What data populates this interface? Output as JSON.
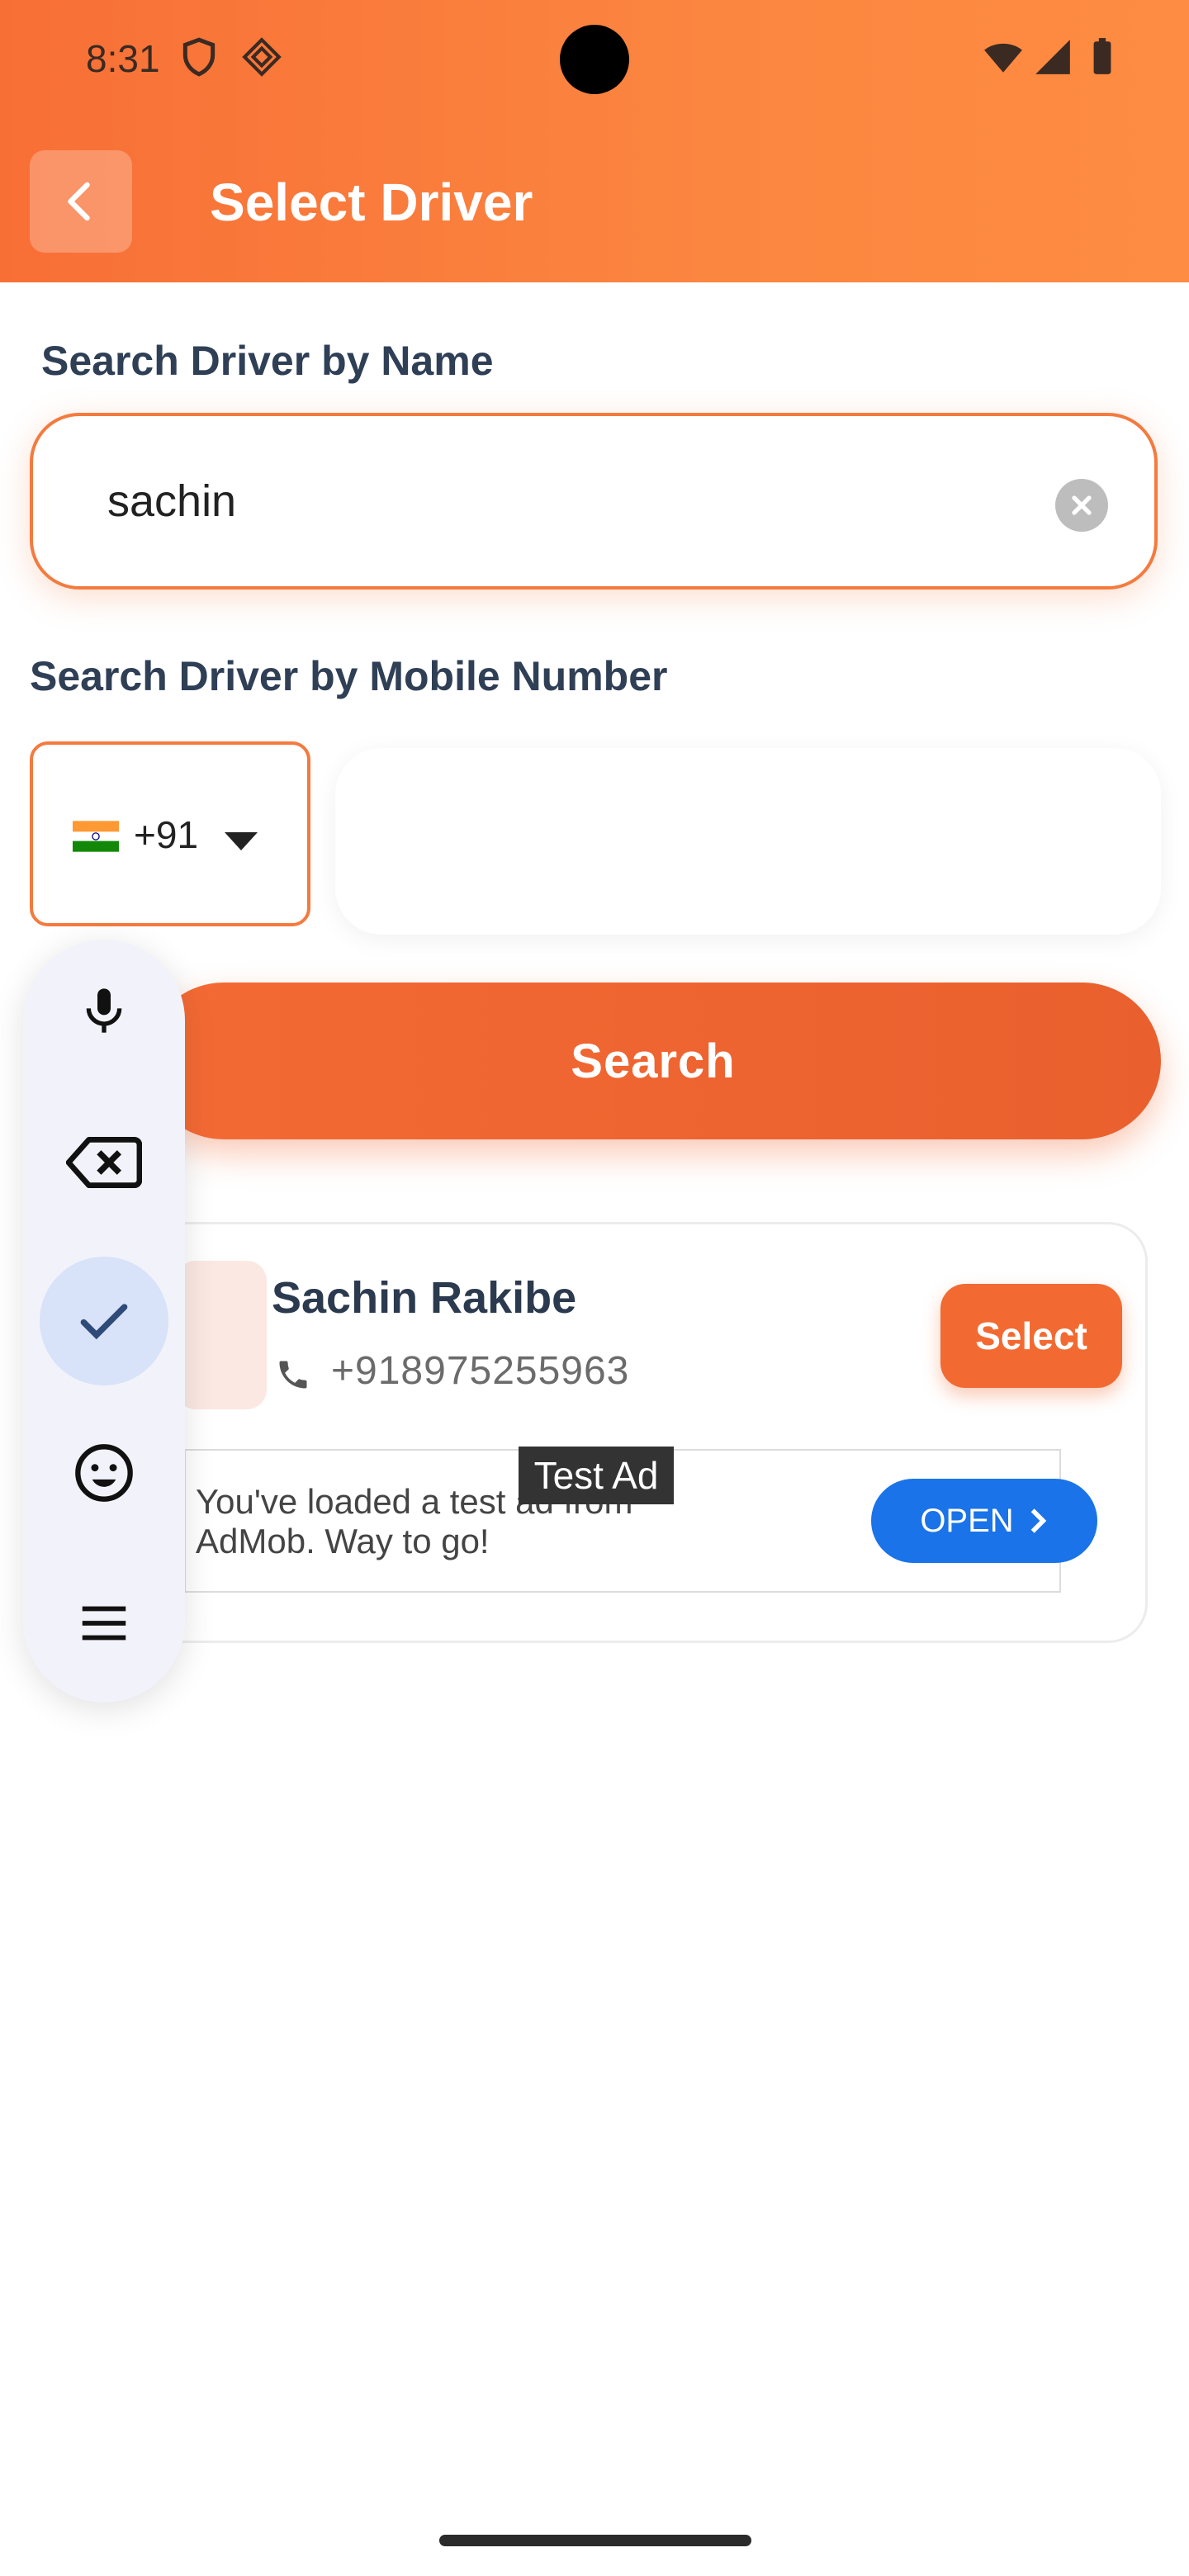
{
  "status_bar": {
    "time": "8:31"
  },
  "header": {
    "title": "Select Driver"
  },
  "search_by_name": {
    "label": "Search Driver by Name",
    "value": "sachin"
  },
  "search_by_mobile": {
    "label": "Search Driver by Mobile Number",
    "country_code": "+91",
    "value": ""
  },
  "search_button": {
    "label": "Search"
  },
  "result": {
    "name": "Sachin Rakibe",
    "phone": "+918975255963",
    "select_label": "Select"
  },
  "ad": {
    "badge": "Test Ad",
    "text": "You've loaded a test ad from AdMob. Way to go!",
    "cta": "OPEN"
  },
  "colors": {
    "accent": "#f26a32",
    "header_from": "#f86f36",
    "header_to": "#ff8c42",
    "ad_button": "#1a73e8"
  },
  "keyboard_panel": {
    "icons": [
      "microphone-icon",
      "backspace-icon",
      "check-icon",
      "emoji-icon",
      "menu-icon"
    ],
    "active": "check-icon"
  }
}
